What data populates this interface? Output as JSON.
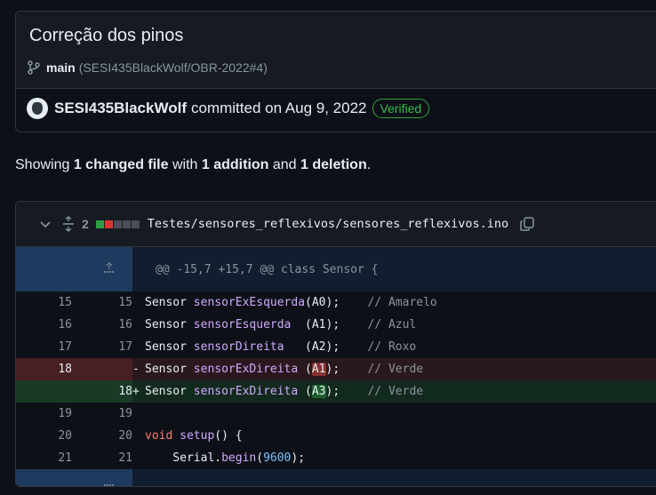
{
  "commit": {
    "title": "Correção dos pinos",
    "branch": "main",
    "pr_ref": "(SESI435BlackWolf/OBR-2022#4)",
    "author": "SESI435BlackWolf",
    "committed_text": "committed on Aug 9, 2022",
    "verified_label": "Verified"
  },
  "summary": {
    "prefix": "Showing ",
    "files": "1 changed file",
    "with": " with ",
    "additions": "1 addition",
    "and": " and ",
    "deletions": "1 deletion",
    "end": "."
  },
  "file": {
    "changes_count": "2",
    "path": "Testes/sensores_reflexivos/sensores_reflexivos.ino",
    "diffstat": [
      "#2ea043",
      "#da3633",
      "#484f58",
      "#484f58",
      "#484f58"
    ],
    "hunk_header": "@@ -15,7 +15,7 @@ class Sensor {",
    "lines": [
      {
        "type": "ctx",
        "old": "15",
        "new": "15",
        "marker": " ",
        "parts": [
          [
            "",
            "Sensor "
          ],
          [
            "t-var",
            "sensorExEsquerda"
          ],
          [
            "",
            "(A0);    "
          ],
          [
            "t-com",
            "// Amarelo"
          ]
        ]
      },
      {
        "type": "ctx",
        "old": "16",
        "new": "16",
        "marker": " ",
        "parts": [
          [
            "",
            "Sensor "
          ],
          [
            "t-var",
            "sensorEsquerda"
          ],
          [
            "",
            "  (A1);    "
          ],
          [
            "t-com",
            "// Azul"
          ]
        ]
      },
      {
        "type": "ctx",
        "old": "17",
        "new": "17",
        "marker": " ",
        "parts": [
          [
            "",
            "Sensor "
          ],
          [
            "t-var",
            "sensorDireita"
          ],
          [
            "",
            "   (A2);    "
          ],
          [
            "t-com",
            "// Roxo"
          ]
        ]
      },
      {
        "type": "del",
        "old": "18",
        "new": "",
        "marker": "-",
        "parts": [
          [
            "",
            "Sensor "
          ],
          [
            "t-var",
            "sensorExDireita"
          ],
          [
            "",
            " ("
          ],
          [
            "word-del",
            "A1"
          ],
          [
            "",
            ");    "
          ],
          [
            "t-com",
            "// Verde"
          ]
        ]
      },
      {
        "type": "add",
        "old": "",
        "new": "18",
        "marker": "+",
        "parts": [
          [
            "",
            "Sensor "
          ],
          [
            "t-var",
            "sensorExDireita"
          ],
          [
            "",
            " ("
          ],
          [
            "word-add",
            "A3"
          ],
          [
            "",
            ");    "
          ],
          [
            "t-com",
            "// Verde"
          ]
        ]
      },
      {
        "type": "ctx",
        "old": "19",
        "new": "19",
        "marker": " ",
        "parts": [
          [
            "",
            ""
          ]
        ]
      },
      {
        "type": "ctx",
        "old": "20",
        "new": "20",
        "marker": " ",
        "parts": [
          [
            "t-kw",
            "void"
          ],
          [
            "",
            " "
          ],
          [
            "t-meth",
            "setup"
          ],
          [
            "",
            "() {"
          ]
        ]
      },
      {
        "type": "ctx",
        "old": "21",
        "new": "21",
        "marker": " ",
        "parts": [
          [
            "",
            "    Serial."
          ],
          [
            "t-meth",
            "begin"
          ],
          [
            "",
            "("
          ],
          [
            "t-num",
            "9600"
          ],
          [
            "",
            ");"
          ]
        ]
      }
    ]
  }
}
